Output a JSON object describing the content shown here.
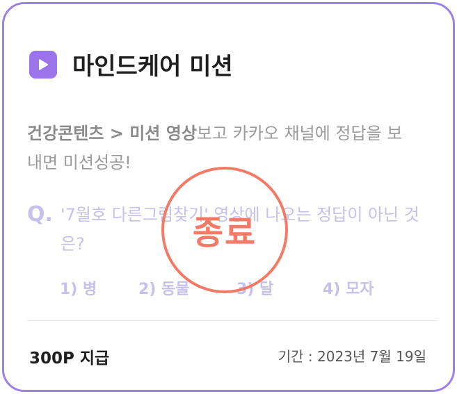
{
  "card": {
    "title": "마인드케어 미션",
    "icon": "play-icon",
    "accent_color": "#9b82e6"
  },
  "description": {
    "part_bold_1": "건강콘텐츠 > 미션 영상",
    "part_regular": "보고 카카오 채널에 정답을 보내면 미션성공!"
  },
  "question": {
    "prefix": "Q.",
    "text": "'7월호 다른그림찾기' 영상에 나오는 정답이 아닌 것은?",
    "options": [
      "1) 병",
      "2) 동물",
      "3) 달",
      "4) 모자"
    ]
  },
  "footer": {
    "reward": "300P 지급",
    "period": "기간 : 2023년 7월 19일"
  },
  "stamp": {
    "label": "종료",
    "color": "#f37a67"
  }
}
